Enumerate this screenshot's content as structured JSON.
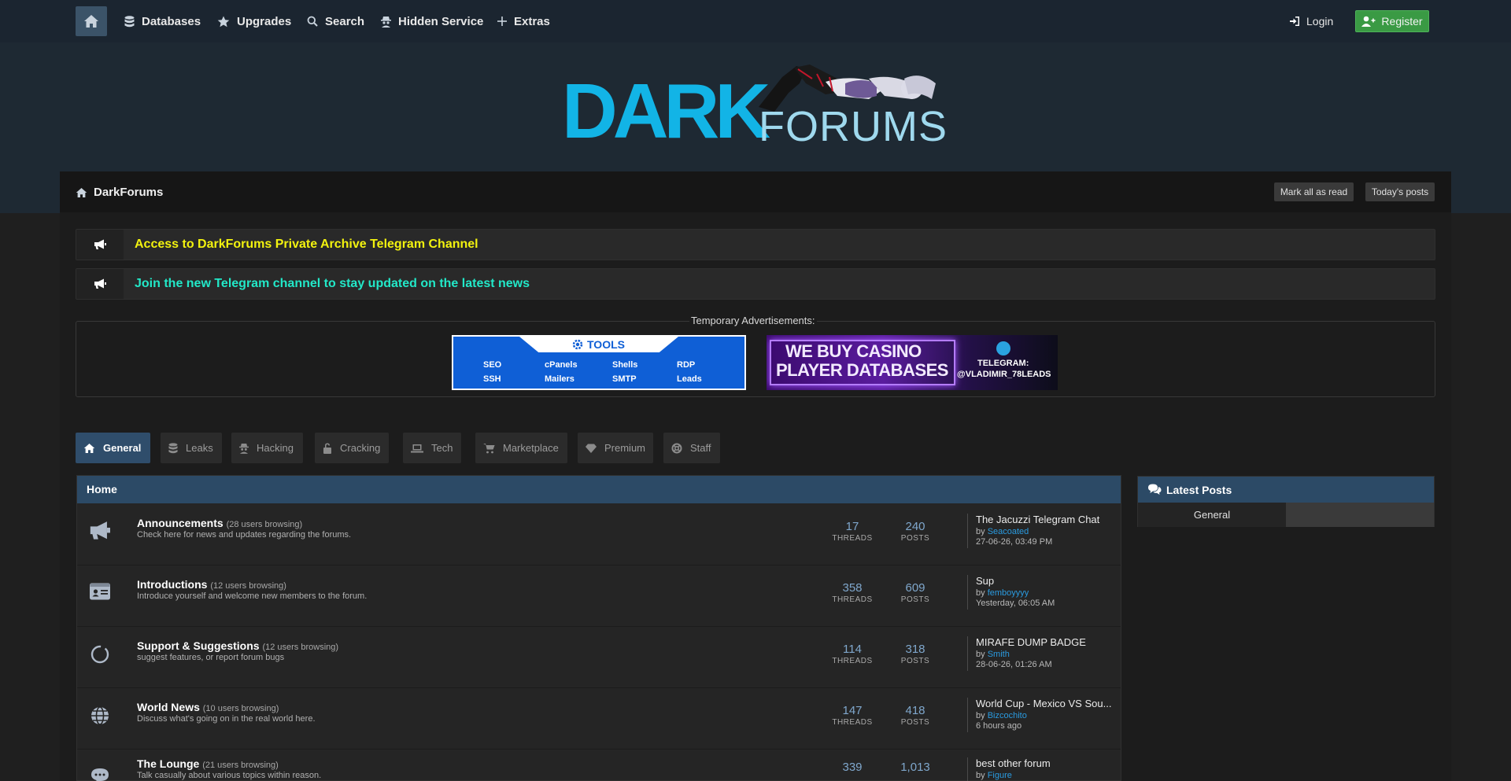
{
  "nav": {
    "items": [
      {
        "label": "Databases",
        "icon": "database-icon"
      },
      {
        "label": "Upgrades",
        "icon": "star-icon"
      },
      {
        "label": "Search",
        "icon": "search-icon"
      },
      {
        "label": "Hidden Service",
        "icon": "spy-icon"
      },
      {
        "label": "Extras",
        "icon": "plus-icon"
      }
    ],
    "login_label": "Login",
    "register_label": "Register"
  },
  "logo": {
    "word1": "DARK",
    "word2": "FORUMS"
  },
  "breadcrumb": {
    "label": "DarkForums"
  },
  "actions": {
    "mark_read": "Mark all as read",
    "todays_posts": "Today's posts"
  },
  "announcements": [
    {
      "text": "Access to DarkForums Private Archive Telegram Channel",
      "color": "#f2f20f"
    },
    {
      "text": "Join the new Telegram channel to stay updated on the latest news",
      "color": "#22e8c8"
    }
  ],
  "ads": {
    "legend": "Temporary Advertisements:",
    "ad1": {
      "title": "TOOLS",
      "cells": [
        "SEO",
        "cPanels",
        "Shells",
        "RDP",
        "SSH",
        "Mailers",
        "SMTP",
        "Leads"
      ]
    },
    "ad2": {
      "line1": "WE BUY CASINO",
      "line2": "PLAYER DATABASES",
      "tg1": "TELEGRAM:",
      "tg2": "@VLADIMIR_78LEADS"
    }
  },
  "categories": [
    {
      "label": "General",
      "active": true
    },
    {
      "label": "Leaks",
      "active": false
    },
    {
      "label": "Hacking",
      "active": false
    },
    {
      "label": "Cracking",
      "active": false
    },
    {
      "label": "Tech",
      "active": false
    },
    {
      "label": "Marketplace",
      "active": false
    },
    {
      "label": "Premium",
      "active": false
    },
    {
      "label": "Staff",
      "active": false
    }
  ],
  "forum": {
    "header": "Home",
    "threads_label": "THREADS",
    "posts_label": "POSTS",
    "by_label": "by",
    "rows": [
      {
        "name": "Announcements",
        "browsing": "(28 users browsing)",
        "desc": "Check here for news and updates regarding the forums.",
        "threads": "17",
        "posts": "240",
        "last_title": "The Jacuzzi Telegram Chat",
        "last_user": "Seacoated",
        "last_date": "27-06-26, 03:49 PM",
        "icon": "megaphone-icon"
      },
      {
        "name": "Introductions",
        "browsing": "(12 users browsing)",
        "desc": "Introduce yourself and welcome new members to the forum.",
        "threads": "358",
        "posts": "609",
        "last_title": "Sup",
        "last_user": "femboyyyy",
        "last_date": "Yesterday, 06:05 AM",
        "icon": "id-card-icon"
      },
      {
        "name": "Support & Suggestions",
        "browsing": "(12 users browsing)",
        "desc": "suggest features, or report forum bugs",
        "threads": "114",
        "posts": "318",
        "last_title": "MIRAFE DUMP BADGE",
        "last_user": "Smith",
        "last_date": "28-06-26, 01:26 AM",
        "icon": "lifebuoy-icon"
      },
      {
        "name": "World News",
        "browsing": "(10 users browsing)",
        "desc": "Discuss what's going on in the real world here.",
        "threads": "147",
        "posts": "418",
        "last_title": "World Cup - Mexico VS Sou...",
        "last_user": "Bizcochito",
        "last_date": "6 hours ago",
        "icon": "globe-icon"
      },
      {
        "name": "The Lounge",
        "browsing": "(21 users browsing)",
        "desc": "Talk casually about various topics within reason.",
        "threads": "339",
        "posts": "1,013",
        "last_title": "best other forum",
        "last_user": "Figure",
        "last_date": "",
        "icon": "chat-icon"
      }
    ]
  },
  "latest": {
    "title": "Latest Posts",
    "tab": "General"
  }
}
